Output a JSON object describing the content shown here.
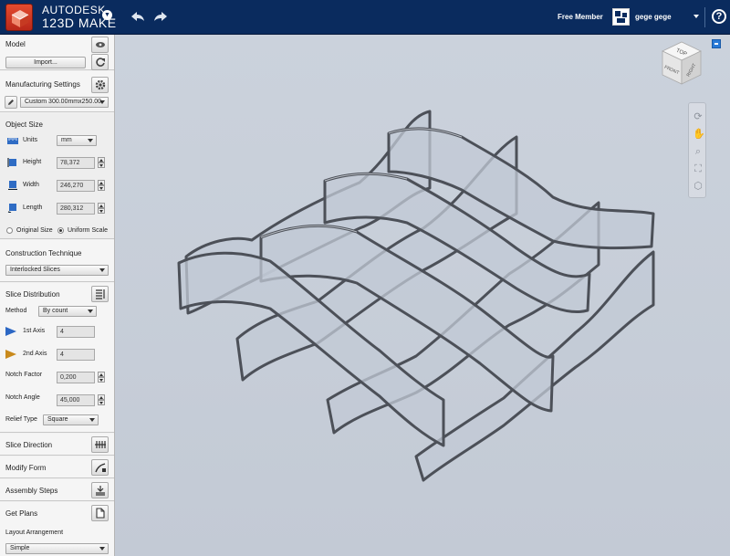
{
  "app": {
    "brand_line1": "AUTODESK",
    "brand_line2": "123D MAKE",
    "member_status": "Free Member",
    "username": "gege gege",
    "help_symbol": "?"
  },
  "colors": {
    "topbar": "#0a2b5e",
    "logo": "#d63a24",
    "viewport_bg": "#c7ced8"
  },
  "sidebar": {
    "model": {
      "title": "Model",
      "import_label": "Import..."
    },
    "manufacturing": {
      "title": "Manufacturing Settings",
      "preset_value": "Custom 300.00mmx250.00"
    },
    "object_size": {
      "title": "Object Size",
      "units_label": "Units",
      "units_value": "mm",
      "height_label": "Height",
      "height_value": "78,372",
      "width_label": "Width",
      "width_value": "246,270",
      "length_label": "Length",
      "length_value": "280,312",
      "original_size_label": "Original Size",
      "uniform_scale_label": "Uniform Scale",
      "selected_scale": "Uniform Scale"
    },
    "construction": {
      "title": "Construction Technique",
      "value": "Interlocked Slices"
    },
    "slice_distribution": {
      "title": "Slice Distribution",
      "method_label": "Method",
      "method_value": "By count",
      "axis1_label": "1st Axis",
      "axis1_value": "4",
      "axis2_label": "2nd Axis",
      "axis2_value": "4",
      "notch_factor_label": "Notch Factor",
      "notch_factor_value": "0,200",
      "notch_angle_label": "Notch Angle",
      "notch_angle_value": "45,000",
      "relief_type_label": "Relief Type",
      "relief_type_value": "Square"
    },
    "slice_direction": {
      "title": "Slice Direction"
    },
    "modify_form": {
      "title": "Modify Form"
    },
    "assembly_steps": {
      "title": "Assembly Steps"
    },
    "get_plans": {
      "title": "Get Plans",
      "layout_label": "Layout Arrangement",
      "layout_value": "Simple"
    }
  },
  "viewcube": {
    "top_label": "TOP",
    "front_label": "FRONT",
    "right_label": "RIGHT"
  },
  "navbar_icons": [
    "orbit-icon",
    "pan-icon",
    "zoom-icon",
    "fit-icon",
    "home-cube-icon"
  ]
}
